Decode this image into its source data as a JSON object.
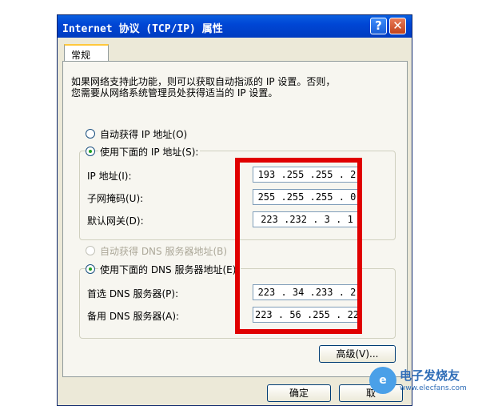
{
  "window": {
    "title": "Internet 协议 (TCP/IP) 属性",
    "help_glyph": "?",
    "close_glyph": "✕"
  },
  "tab": {
    "label": "常规"
  },
  "description": {
    "line1": "如果网络支持此功能，则可以获取自动指派的 IP 设置。否则，",
    "line2": "您需要从网络系统管理员处获得适当的 IP 设置。"
  },
  "ip_section": {
    "auto_label": "自动获得 IP 地址(O)",
    "auto_selected": false,
    "manual_label": "使用下面的 IP 地址(S):",
    "manual_selected": true,
    "fields": [
      {
        "label": "IP 地址(I):",
        "value": "193 .255 .255 . 2"
      },
      {
        "label": "子网掩码(U):",
        "value": "255 .255 .255 . 0"
      },
      {
        "label": "默认网关(D):",
        "value": "223 .232 . 3 . 1"
      }
    ]
  },
  "dns_section": {
    "auto_label": "自动获得 DNS 服务器地址(B)",
    "auto_disabled": true,
    "manual_label": "使用下面的 DNS 服务器地址(E):",
    "manual_selected": true,
    "fields": [
      {
        "label": "首选 DNS 服务器(P):",
        "value": "223 . 34 .233 . 2"
      },
      {
        "label": "备用 DNS 服务器(A):",
        "value": "223 . 56 .255 . 22"
      }
    ]
  },
  "buttons": {
    "advanced": "高级(V)...",
    "ok": "确定",
    "cancel": "取"
  },
  "watermark": {
    "text": "电子发烧友",
    "url": "www.elecfans.com"
  },
  "colors": {
    "title_bar": "#0046d5",
    "highlight_box": "#e00000",
    "dialog_bg": "#ece9d8"
  }
}
